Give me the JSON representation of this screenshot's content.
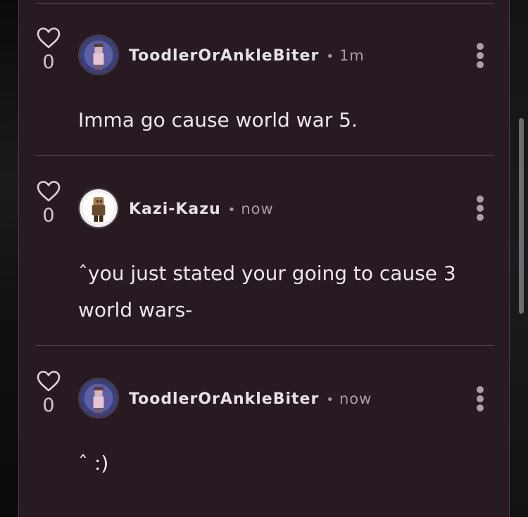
{
  "comments": [
    {
      "username": "ToodlerOrAnkleBiter",
      "time": "1m",
      "text": "Imma go cause world war 5.",
      "likes": "0"
    },
    {
      "username": "Kazi-Kazu",
      "time": "now",
      "text": "ˆyou just stated your going to cause 3 world wars-",
      "likes": "0"
    },
    {
      "username": "ToodlerOrAnkleBiter",
      "time": "now",
      "text": "ˆ :)",
      "likes": "0"
    }
  ],
  "separator": "•",
  "icons": {
    "like": "heart-icon",
    "menu": "more-vertical-icon"
  },
  "colors": {
    "panel_bg": "#281a23",
    "text": "#ece7ea",
    "muted": "#a59da2"
  }
}
